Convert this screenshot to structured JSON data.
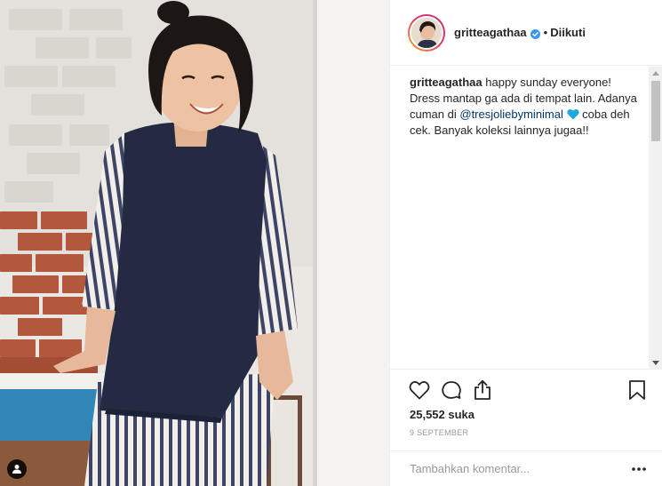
{
  "post": {
    "username": "gritteagathaa",
    "follow_status": "Diikuti",
    "dot": "•",
    "verified": true
  },
  "caption": {
    "username": "gritteagathaa",
    "text_before": " happy sunday everyone! Dress mantap ga ada di tempat lain. Adanya cuman di ",
    "mention": "@tresjoliebyminimal",
    "text_after": " coba deh cek. Banyak koleksi lainnya jugaa!!",
    "emoji": "blue-heart"
  },
  "actions": {
    "like_icon": "heart-outline-icon",
    "comment_icon": "comment-bubble-icon",
    "share_icon": "share-upload-icon",
    "save_icon": "bookmark-icon"
  },
  "likes": "25,552 suka",
  "date": "9 SEPTEMBER",
  "comment": {
    "placeholder": "Tambahkan komentar...",
    "more_icon": "more-options-icon"
  },
  "photo": {
    "tag_icon": "user-tag-icon"
  },
  "colors": {
    "accent_link": "#003569",
    "verified_blue": "#3897f0",
    "heart_blue": "#1fa9df",
    "border": "#efefef",
    "text": "#262626",
    "muted": "#999999"
  }
}
